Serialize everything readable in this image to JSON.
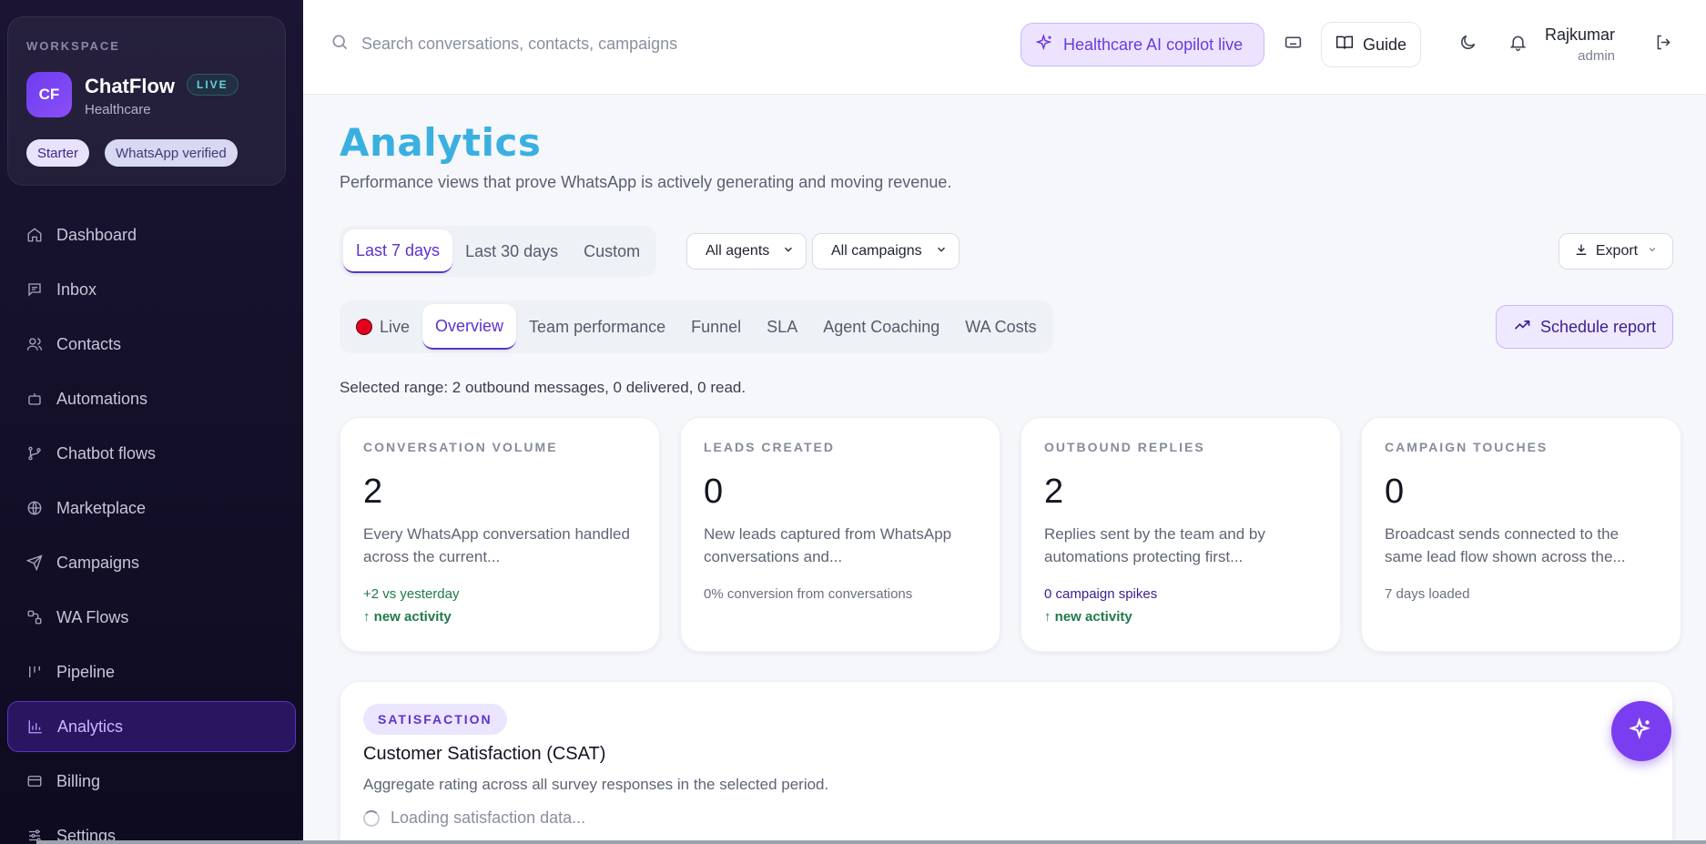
{
  "workspace": {
    "label": "WORKSPACE",
    "avatar": "CF",
    "name": "ChatFlow",
    "live_badge": "LIVE",
    "industry": "Healthcare",
    "chips": [
      "Starter",
      "WhatsApp verified"
    ]
  },
  "sidebar": {
    "items": [
      {
        "label": "Dashboard",
        "icon": "home-icon"
      },
      {
        "label": "Inbox",
        "icon": "inbox-icon"
      },
      {
        "label": "Contacts",
        "icon": "users-icon"
      },
      {
        "label": "Automations",
        "icon": "bot-icon"
      },
      {
        "label": "Chatbot flows",
        "icon": "branch-icon"
      },
      {
        "label": "Marketplace",
        "icon": "globe-icon"
      },
      {
        "label": "Campaigns",
        "icon": "send-icon"
      },
      {
        "label": "WA Flows",
        "icon": "flow-icon"
      },
      {
        "label": "Pipeline",
        "icon": "pipeline-icon"
      },
      {
        "label": "Analytics",
        "icon": "bar-chart-icon",
        "active": true
      },
      {
        "label": "Billing",
        "icon": "card-icon"
      },
      {
        "label": "Settings",
        "icon": "settings-icon"
      }
    ]
  },
  "header": {
    "search_placeholder": "Search conversations, contacts, campaigns",
    "copilot_label": "Healthcare AI copilot live",
    "guide_label": "Guide",
    "user_name": "Rajkumar",
    "user_role": "admin"
  },
  "page": {
    "title": "Analytics",
    "subtitle": "Performance views that prove WhatsApp is actively generating and moving revenue.",
    "ranges": [
      "Last 7 days",
      "Last 30 days",
      "Custom"
    ],
    "agent_select": "All agents",
    "campaign_select": "All campaigns",
    "export_label": "Export",
    "tabs": [
      "Live",
      "Overview",
      "Team performance",
      "Funnel",
      "SLA",
      "Agent Coaching",
      "WA Costs"
    ],
    "schedule_label": "Schedule report",
    "range_note": "Selected range: 2 outbound messages, 0 delivered, 0 read."
  },
  "cards": [
    {
      "label": "CONVERSATION VOLUME",
      "value": "2",
      "desc": "Every WhatsApp conversation handled across the current...",
      "foot1": "+2 vs yesterday",
      "foot2": "↑ new activity"
    },
    {
      "label": "LEADS CREATED",
      "value": "0",
      "desc": "New leads captured from WhatsApp conversations and...",
      "foot1": "0% conversion from conversations",
      "foot2": ""
    },
    {
      "label": "OUTBOUND REPLIES",
      "value": "2",
      "desc": "Replies sent by the team and by automations protecting first...",
      "foot1": "0 campaign spikes",
      "foot2": "↑ new activity"
    },
    {
      "label": "CAMPAIGN TOUCHES",
      "value": "0",
      "desc": "Broadcast sends connected to the same lead flow shown across the...",
      "foot1": "7 days loaded",
      "foot2": ""
    }
  ],
  "csat": {
    "tag": "SATISFACTION",
    "title": "Customer Satisfaction (CSAT)",
    "subtitle": "Aggregate rating across all survey responses in the selected period.",
    "loading": "Loading satisfaction data..."
  },
  "colors": {
    "accent": "#5b32cf",
    "title": "#3ab0e0",
    "sidebar_bg": "#14102a",
    "live_dot": "#e3001b"
  }
}
